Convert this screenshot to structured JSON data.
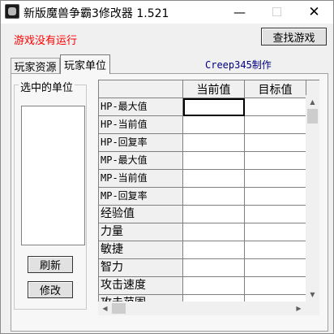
{
  "window": {
    "title": "新版魔兽争霸3修改器 1.521",
    "minimize_glyph": "—",
    "maximize_glyph": "☐",
    "close_glyph": "✕"
  },
  "status": {
    "text": "游戏没有运行",
    "color": "#ff0000"
  },
  "toolbar": {
    "find_game_label": "查找游戏"
  },
  "tabs": [
    {
      "label": "玩家资源",
      "active": false
    },
    {
      "label": "玩家单位",
      "active": true
    }
  ],
  "credit": {
    "text": "Creep345制作",
    "color": "#000080"
  },
  "unit_panel": {
    "group_label": "选中的单位",
    "refresh_label": "刷新",
    "modify_label": "修改"
  },
  "grid": {
    "columns": [
      "",
      "当前值",
      "目标值"
    ],
    "rows": [
      {
        "label": "HP-最大值",
        "current": "",
        "target": ""
      },
      {
        "label": "HP-当前值",
        "current": "",
        "target": ""
      },
      {
        "label": "HP-回复率",
        "current": "",
        "target": ""
      },
      {
        "label": "MP-最大值",
        "current": "",
        "target": ""
      },
      {
        "label": "MP-当前值",
        "current": "",
        "target": ""
      },
      {
        "label": "MP-回复率",
        "current": "",
        "target": ""
      },
      {
        "label": "经验值",
        "current": "",
        "target": ""
      },
      {
        "label": "力量",
        "current": "",
        "target": ""
      },
      {
        "label": "敏捷",
        "current": "",
        "target": ""
      },
      {
        "label": "智力",
        "current": "",
        "target": ""
      },
      {
        "label": "攻击速度",
        "current": "",
        "target": ""
      },
      {
        "label": "攻击范围",
        "current": "",
        "target": ""
      }
    ]
  },
  "icons": {
    "app": "warcraft-icon",
    "scroll_up": "▲",
    "scroll_down": "▼",
    "scroll_left": "◀",
    "scroll_right": "▶"
  }
}
